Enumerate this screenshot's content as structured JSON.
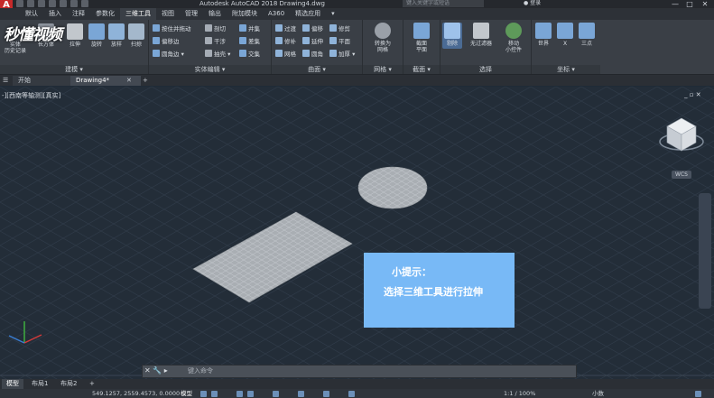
{
  "app": {
    "icon_letter": "A",
    "title": "Autodesk AutoCAD 2018    Drawing4.dwg",
    "search_placeholder": "键入关键字或短语",
    "signin": "登录",
    "minimize": "—",
    "maximize": "□",
    "close": "✕"
  },
  "ribbon_tabs": [
    "默认",
    "插入",
    "注释",
    "参数化",
    "三维工具",
    "视图",
    "管理",
    "输出",
    "附加模块",
    "A360",
    "精选应用",
    "▾"
  ],
  "active_tab": "三维工具",
  "groups": {
    "modeling": {
      "title": "建模 ▾",
      "solid_history": "实体\n历史记录",
      "box": "长方体",
      "extrude": "拉伸",
      "revolve": "旋转",
      "loft": "放样",
      "sweep": "扫掠"
    },
    "solid_edit": {
      "title": "实体编辑 ▾",
      "items": [
        "按住并拖动",
        "偏移边",
        "圆角边 ▾",
        "剖切",
        "干涉",
        "抽壳 ▾",
        "并集",
        "差集",
        "交集"
      ]
    },
    "surface": {
      "title": "曲面 ▾",
      "items": [
        "过渡",
        "修补",
        "网格",
        "偏移",
        "延伸",
        "圆角",
        "修剪",
        "平面",
        "加厚 ▾"
      ]
    },
    "mesh": {
      "title": "网格 ▾",
      "convert": "转换为\n网格"
    },
    "section": {
      "title": "截面 ▾",
      "section_plane": "截面\n平面"
    },
    "selection": {
      "title": "选择",
      "culling": "剔除",
      "no_filter": "无过滤器",
      "gizmo": "移动\n小控件"
    },
    "coordinates": {
      "title": "坐标 ▾",
      "world": "世界",
      "x": "X",
      "three_point": "三点"
    }
  },
  "watermark": "秒懂视频",
  "file_tabs": {
    "menu": "☰",
    "start": "开始",
    "drawing": "Drawing4*",
    "close": "✕",
    "add": "+"
  },
  "viewport": {
    "label": "-][西南等轴测][真实]",
    "controls": "_ ▫ ✕",
    "wcs": "WCS"
  },
  "tip": {
    "title": "小提示：",
    "text": "选择三维工具进行拉伸"
  },
  "command": {
    "icons": "✕ 🔧 ▸",
    "placeholder": "键入命令"
  },
  "layout_tabs": [
    "模型",
    "布局1",
    "布局2",
    "+"
  ],
  "active_layout": "模型",
  "status": {
    "coords": "549.1257, 2559.4573, 0.0000",
    "model": "模型",
    "scale": "1:1 / 100%",
    "units": "小数"
  },
  "colors": {
    "accent": "#78b9f6",
    "app_red": "#c62a2a",
    "plane": "#a9aeb3"
  }
}
